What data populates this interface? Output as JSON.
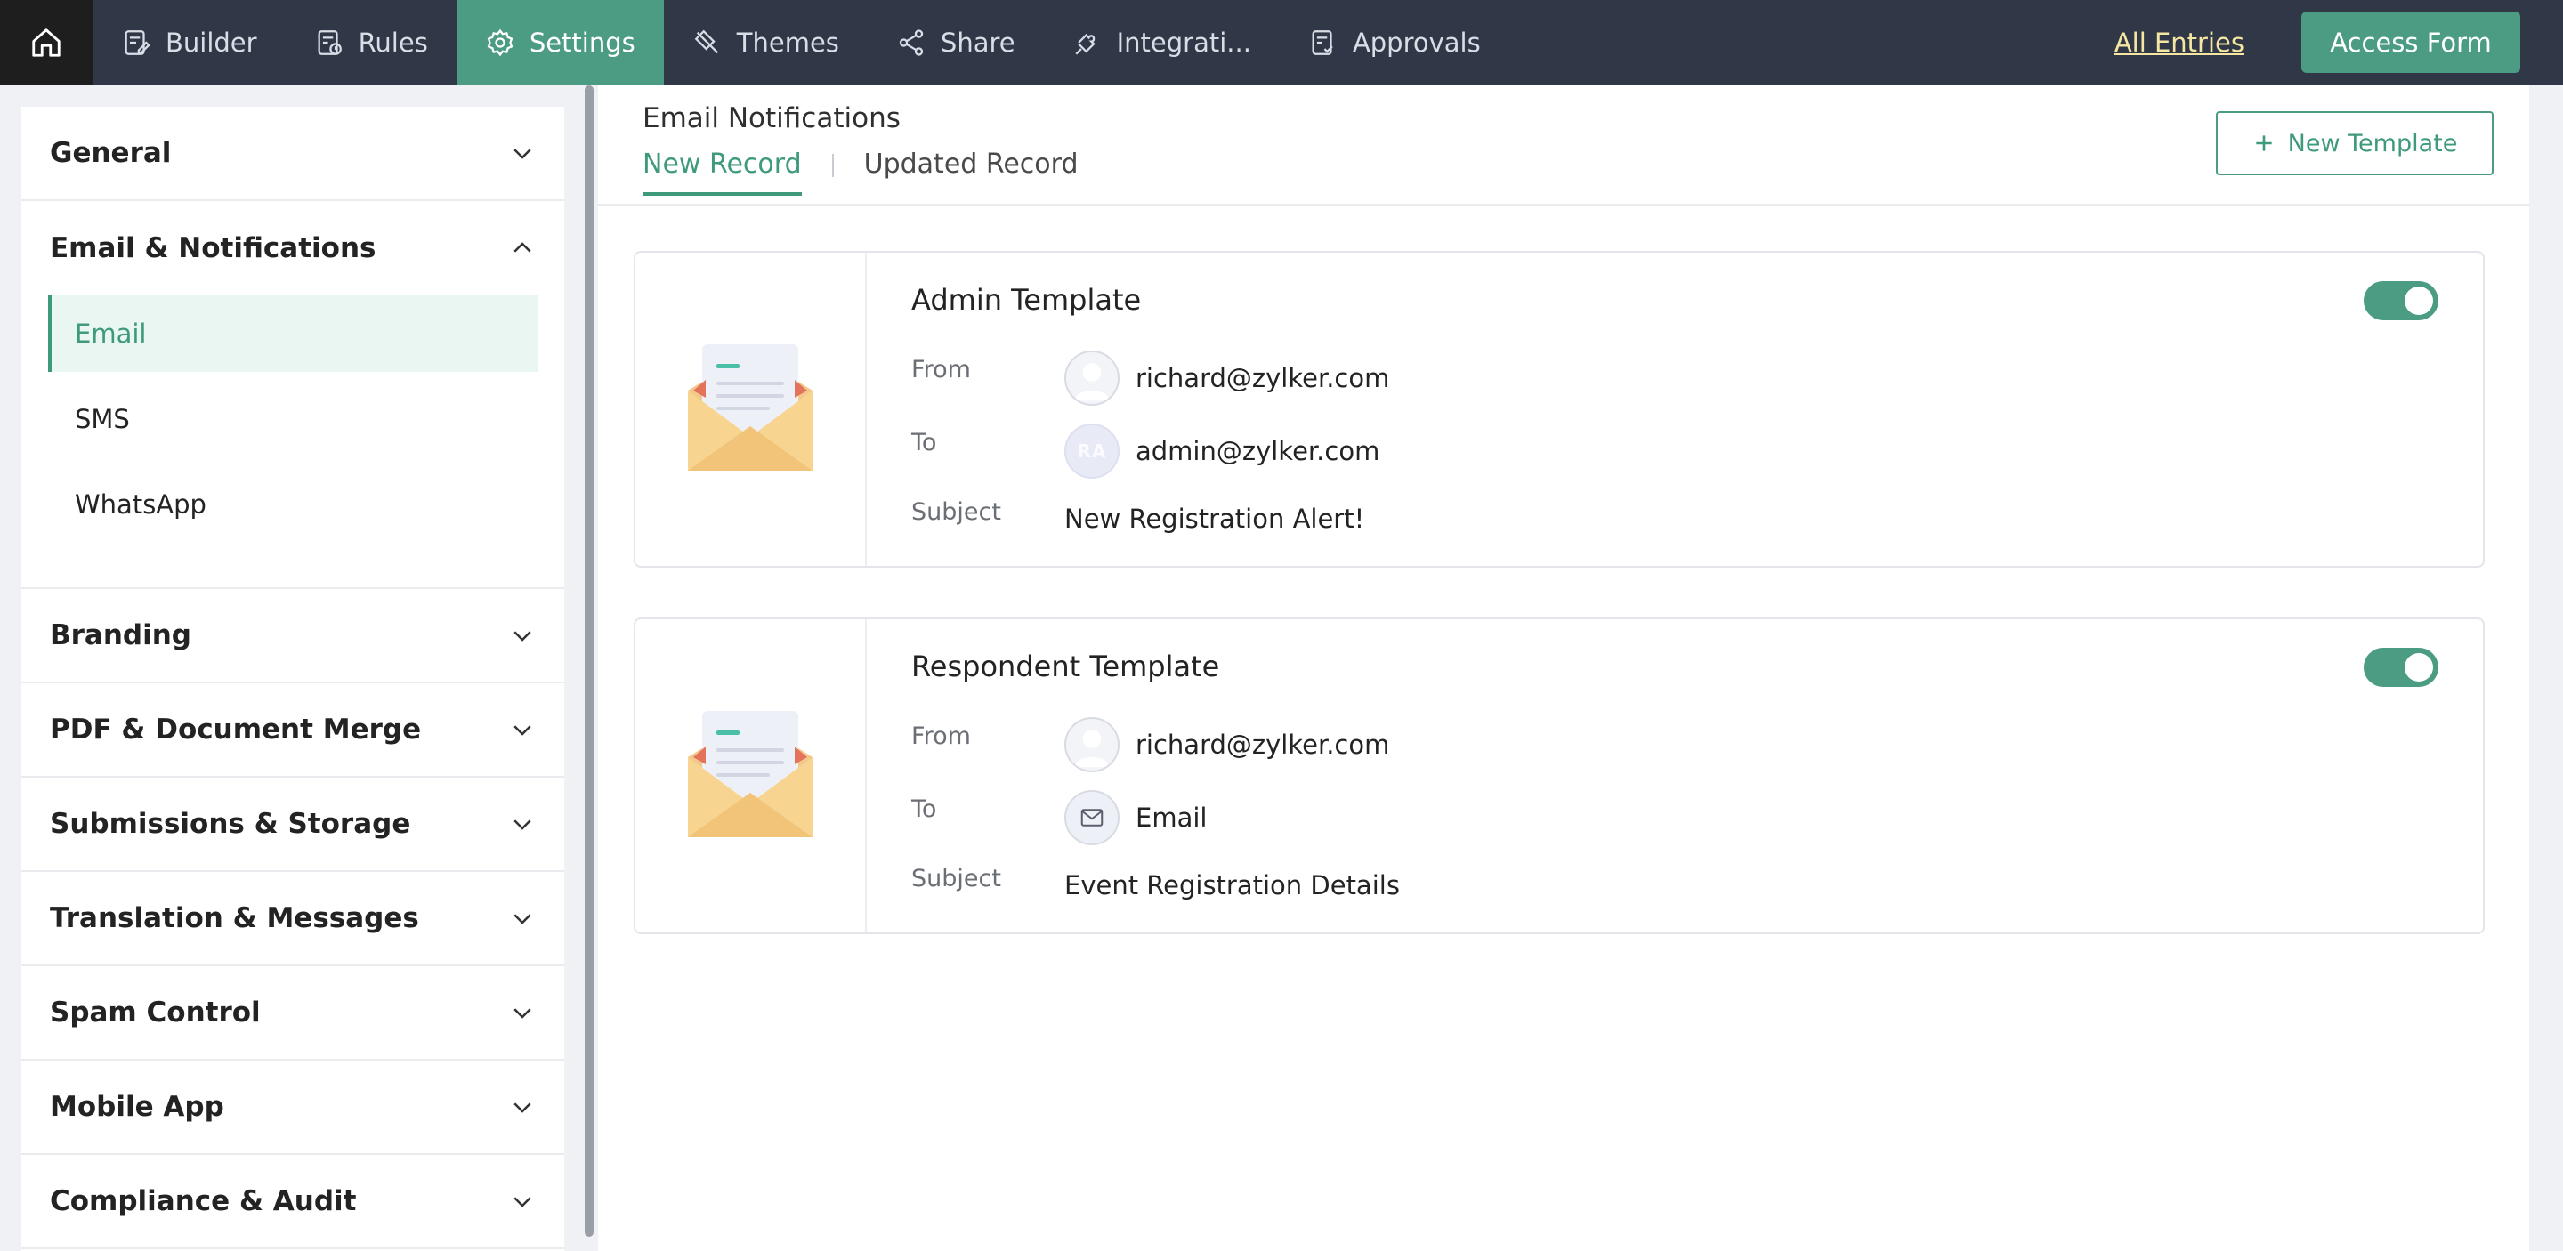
{
  "nav": {
    "tabs": [
      {
        "label": "Builder",
        "icon": "builder-icon"
      },
      {
        "label": "Rules",
        "icon": "rules-icon"
      },
      {
        "label": "Settings",
        "icon": "gear-icon",
        "active": true
      },
      {
        "label": "Themes",
        "icon": "brush-icon"
      },
      {
        "label": "Share",
        "icon": "share-icon"
      },
      {
        "label": "Integrati...",
        "icon": "puzzle-icon"
      },
      {
        "label": "Approvals",
        "icon": "approvals-icon"
      }
    ],
    "all_entries": "All Entries",
    "access_form": "Access Form"
  },
  "sidebar": {
    "sections": [
      {
        "label": "General",
        "expanded": false
      },
      {
        "label": "Email & Notifications",
        "expanded": true,
        "items": [
          {
            "label": "Email",
            "active": true
          },
          {
            "label": "SMS",
            "active": false
          },
          {
            "label": "WhatsApp",
            "active": false
          }
        ]
      },
      {
        "label": "Branding",
        "expanded": false
      },
      {
        "label": "PDF & Document Merge",
        "expanded": false
      },
      {
        "label": "Submissions & Storage",
        "expanded": false
      },
      {
        "label": "Translation & Messages",
        "expanded": false
      },
      {
        "label": "Spam Control",
        "expanded": false
      },
      {
        "label": "Mobile App",
        "expanded": false
      },
      {
        "label": "Compliance & Audit",
        "expanded": false
      }
    ]
  },
  "main": {
    "title": "Email Notifications",
    "tabs": [
      {
        "label": "New Record",
        "active": true
      },
      {
        "label": "Updated Record",
        "active": false
      }
    ],
    "new_template": "New Template",
    "labels": {
      "from": "From",
      "to": "To",
      "subject": "Subject"
    },
    "templates": [
      {
        "title": "Admin Template",
        "enabled": true,
        "from": "richard@zylker.com",
        "to": "admin@zylker.com",
        "to_initials": "RA",
        "subject": "New Registration Alert!"
      },
      {
        "title": "Respondent Template",
        "enabled": true,
        "from": "richard@zylker.com",
        "to": "Email",
        "subject": "Event Registration Details"
      }
    ]
  },
  "colors": {
    "accent": "#4b9c82",
    "topbar": "#303848",
    "link": "#f5e7a1"
  }
}
